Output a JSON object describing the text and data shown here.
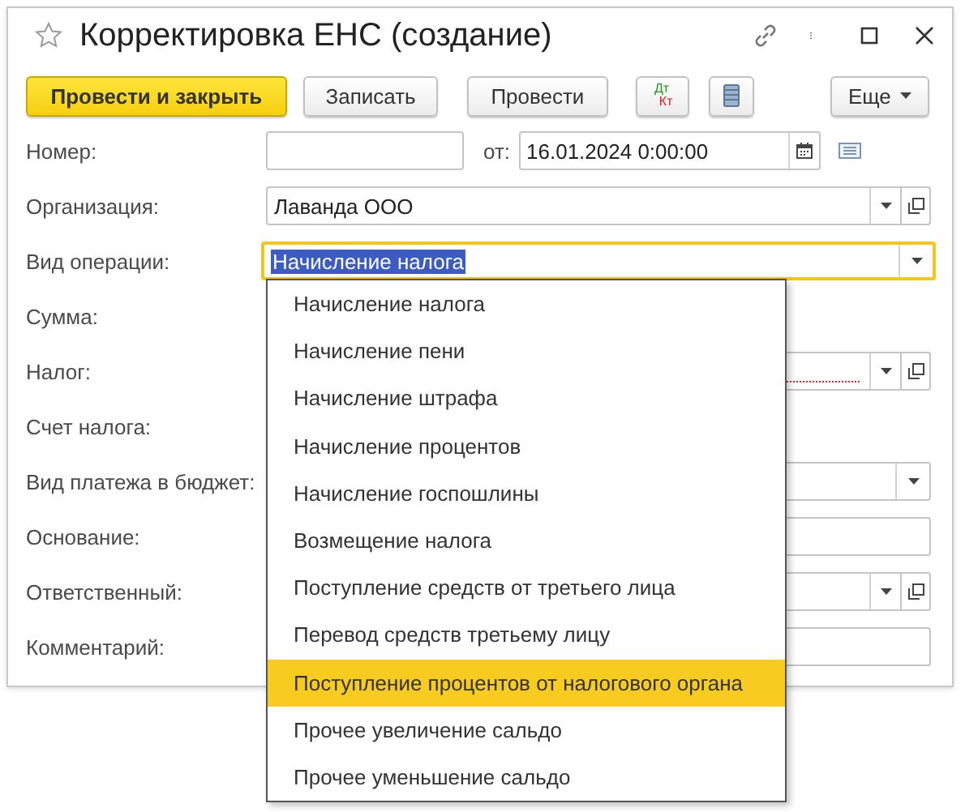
{
  "window": {
    "title": "Корректировка ЕНС (создание)",
    "favorite": false
  },
  "toolbar": [
    {
      "kind": "primary",
      "label": "Провести и закрыть"
    },
    {
      "kind": "normal",
      "label": "Записать"
    },
    {
      "kind": "normal",
      "label": "Провести"
    },
    {
      "kind": "dtkt",
      "dt": "Дт",
      "kt": "Кт"
    },
    {
      "kind": "list"
    },
    {
      "kind": "menu",
      "label": "Еще"
    }
  ],
  "fields": [
    {
      "kind": "number",
      "label": "Номер:",
      "date_label": "от:",
      "date_value": "16.01.2024  0:00:00"
    },
    {
      "kind": "ref",
      "label": "Организация:",
      "value": "Лаванда ООО",
      "required": false
    },
    {
      "kind": "select",
      "label": "Вид операции:",
      "value": "Начисление налога",
      "focused": true
    },
    {
      "kind": "short",
      "label": "Сумма:"
    },
    {
      "kind": "ref",
      "label": "Налог:",
      "required": true
    },
    {
      "kind": "short",
      "label": "Счет налога:"
    },
    {
      "kind": "select",
      "label": "Вид платежа в бюджет:",
      "focused": false
    },
    {
      "kind": "text",
      "label": "Основание:"
    },
    {
      "kind": "ref",
      "label": "Ответственный:",
      "required": false
    },
    {
      "kind": "text",
      "label": "Комментарий:"
    }
  ],
  "dropdown": {
    "items": [
      {
        "label": "Начисление налога",
        "selected": false
      },
      {
        "label": "Начисление пени",
        "selected": false
      },
      {
        "label": "Начисление штрафа",
        "selected": false
      },
      {
        "label": "Начисление процентов",
        "selected": false
      },
      {
        "label": "Начисление госпошлины",
        "selected": false
      },
      {
        "label": "Возмещение налога",
        "selected": false
      },
      {
        "label": "Поступление средств от третьего лица",
        "selected": false
      },
      {
        "label": "Перевод средств третьему лицу",
        "selected": false
      },
      {
        "label": "Поступление процентов от налогового органа",
        "selected": true
      },
      {
        "label": "Прочее увеличение сальдо",
        "selected": false
      },
      {
        "label": "Прочее уменьшение сальдо",
        "selected": false
      }
    ]
  }
}
